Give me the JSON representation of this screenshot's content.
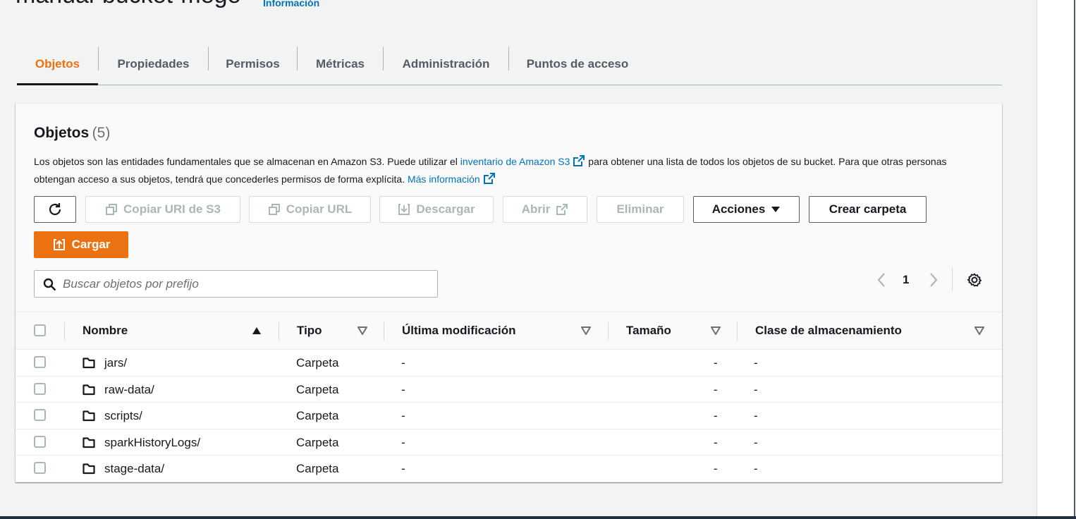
{
  "header": {
    "bucket_name": "manual-bucket-mege",
    "info_link": "Información"
  },
  "tabs": [
    {
      "label": "Objetos",
      "active": true
    },
    {
      "label": "Propiedades"
    },
    {
      "label": "Permisos"
    },
    {
      "label": "Métricas"
    },
    {
      "label": "Administración"
    },
    {
      "label": "Puntos de acceso"
    }
  ],
  "objects_panel": {
    "title": "Objetos",
    "count": "(5)",
    "desc_part1": "Los objetos son las entidades fundamentales que se almacenan en Amazon S3. Puede utilizar el ",
    "desc_link1": "inventario de Amazon S3",
    "desc_part2": " para obtener una lista de todos los objetos de su bucket. Para que otras personas obtengan acceso a sus objetos, tendrá que concederles permisos de forma explícita. ",
    "desc_link2": "Más información"
  },
  "toolbar": {
    "refresh_icon": "refresh-icon",
    "copy_uri": "Copiar URI de S3",
    "copy_url": "Copiar URL",
    "download": "Descargar",
    "open": "Abrir",
    "delete": "Eliminar",
    "actions": "Acciones",
    "create_folder": "Crear carpeta",
    "upload": "Cargar"
  },
  "search": {
    "placeholder": "Buscar objetos por prefijo",
    "value": ""
  },
  "pagination": {
    "current_page": "1"
  },
  "table": {
    "columns": [
      "Nombre",
      "Tipo",
      "Última modificación",
      "Tamaño",
      "Clase de almacenamiento"
    ],
    "rows": [
      {
        "name": "jars/",
        "type": "Carpeta",
        "modified": "-",
        "size": "-",
        "storage_class": "-"
      },
      {
        "name": "raw-data/",
        "type": "Carpeta",
        "modified": "-",
        "size": "-",
        "storage_class": "-"
      },
      {
        "name": "scripts/",
        "type": "Carpeta",
        "modified": "-",
        "size": "-",
        "storage_class": "-"
      },
      {
        "name": "sparkHistoryLogs/",
        "type": "Carpeta",
        "modified": "-",
        "size": "-",
        "storage_class": "-"
      },
      {
        "name": "stage-data/",
        "type": "Carpeta",
        "modified": "-",
        "size": "-",
        "storage_class": "-"
      }
    ]
  },
  "colors": {
    "accent_orange": "#ec7211",
    "link_blue": "#0073bb",
    "text_dark": "#16191f",
    "text_muted": "#545b64",
    "disabled": "#aab7b8"
  }
}
